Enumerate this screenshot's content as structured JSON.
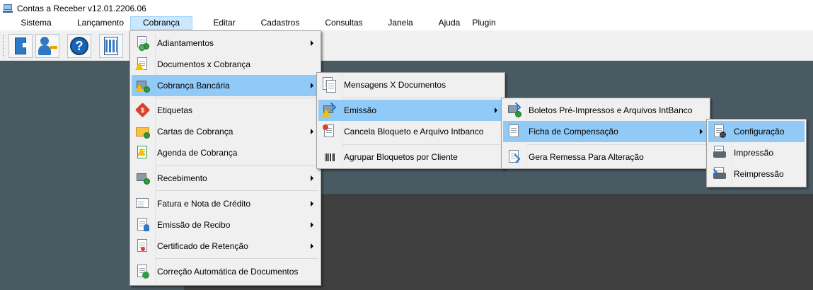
{
  "window": {
    "title": "Contas a Receber v12.01.2206.06"
  },
  "menubar": {
    "items": [
      {
        "label": "Sistema"
      },
      {
        "label": "Lançamento"
      },
      {
        "label": "Cobrança",
        "active": true
      },
      {
        "label": "Editar"
      },
      {
        "label": "Cadastros"
      },
      {
        "label": "Consultas"
      },
      {
        "label": "Janela"
      },
      {
        "label": "Ajuda"
      },
      {
        "label": "Plugin"
      }
    ]
  },
  "toolbar": {
    "buttons": [
      {
        "icon": "exit-door-icon"
      },
      {
        "icon": "user-key-icon"
      },
      {
        "icon": "help-icon",
        "glyph": "?"
      },
      {
        "icon": "calculator-icon"
      }
    ]
  },
  "menus": {
    "cobranca": {
      "items": [
        {
          "label": "Adiantamentos",
          "icon": "coins-document-icon",
          "submenu": true
        },
        {
          "label": "Documentos x Cobrança",
          "icon": "warning-document-icon",
          "submenu": false
        },
        {
          "label": "Cobrança Bancária",
          "icon": "bank-warning-icon",
          "submenu": true,
          "highlighted": true
        },
        {
          "label": "Etiquetas",
          "icon": "price-tag-icon",
          "submenu": false
        },
        {
          "label": "Cartas de Cobrança",
          "icon": "envelope-letter-icon",
          "submenu": true
        },
        {
          "label": "Agenda de Cobrança",
          "icon": "agenda-warning-icon",
          "submenu": false
        },
        {
          "label": "Recebimento",
          "icon": "bank-coin-icon",
          "submenu": true
        },
        {
          "label": "Fatura e Nota de Crédito",
          "icon": "invoice-icon",
          "submenu": true
        },
        {
          "label": "Emissão de Recibo",
          "icon": "receipt-person-icon",
          "submenu": true
        },
        {
          "label": "Certificado de Retenção",
          "icon": "certificate-icon",
          "submenu": true
        },
        {
          "label": "Correção Automática de Documentos",
          "icon": "document-check-icon",
          "submenu": false
        }
      ]
    },
    "cobranca_bancaria": {
      "items": [
        {
          "label": "Mensagens X Documentos",
          "icon": "messages-documents-icon",
          "submenu": false
        },
        {
          "label": "Emissão",
          "icon": "emission-warning-icon",
          "submenu": true,
          "highlighted": true
        },
        {
          "label": "Cancela Bloqueto e Arquivo Intbanco",
          "icon": "cancel-document-icon",
          "submenu": false
        },
        {
          "label": "Agrupar Bloquetos por Cliente",
          "icon": "barcode-group-icon",
          "submenu": false
        }
      ]
    },
    "emissao": {
      "items": [
        {
          "label": "Boletos Pré-Impressos e Arquivos IntBanco",
          "icon": "preprinted-boleto-icon",
          "submenu": false
        },
        {
          "label": "Ficha de Compensação",
          "icon": "clearing-form-icon",
          "submenu": true,
          "highlighted": true
        },
        {
          "label": "Gera Remessa Para Alteração",
          "icon": "remittance-refresh-icon",
          "submenu": false
        }
      ]
    },
    "ficha_compensacao": {
      "items": [
        {
          "label": "Configuração",
          "icon": "config-gear-icon",
          "highlighted": true
        },
        {
          "label": "Impressão",
          "icon": "printer-icon"
        },
        {
          "label": "Reimpressão",
          "icon": "reprint-icon"
        }
      ]
    }
  },
  "colors": {
    "highlight": "#91c9f7",
    "menu_bg": "#f0f0f0",
    "workspace": "#4a5a63",
    "active_menubar": "#cce8ff"
  }
}
